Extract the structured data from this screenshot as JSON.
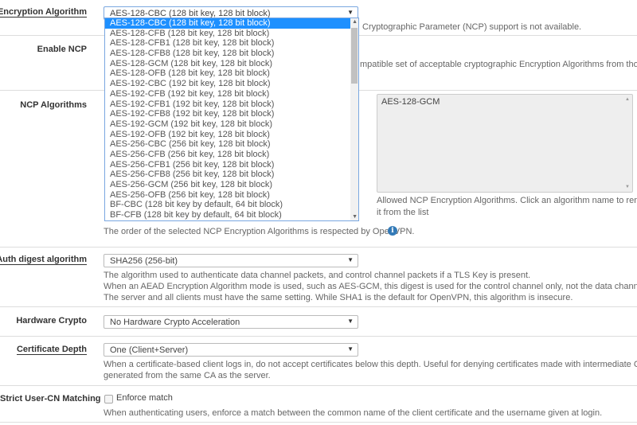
{
  "encryption": {
    "label": "Encryption Algorithm",
    "value": "AES-128-CBC (128 bit key, 128 bit block)",
    "help": "Cryptographic Parameter (NCP) support is not available.",
    "options": [
      "AES-128-CBC (128 bit key, 128 bit block)",
      "AES-128-CFB (128 bit key, 128 bit block)",
      "AES-128-CFB1 (128 bit key, 128 bit block)",
      "AES-128-CFB8 (128 bit key, 128 bit block)",
      "AES-128-GCM (128 bit key, 128 bit block)",
      "AES-128-OFB (128 bit key, 128 bit block)",
      "AES-192-CBC (192 bit key, 128 bit block)",
      "AES-192-CFB (192 bit key, 128 bit block)",
      "AES-192-CFB1 (192 bit key, 128 bit block)",
      "AES-192-CFB8 (192 bit key, 128 bit block)",
      "AES-192-GCM (192 bit key, 128 bit block)",
      "AES-192-OFB (192 bit key, 128 bit block)",
      "AES-256-CBC (256 bit key, 128 bit block)",
      "AES-256-CFB (256 bit key, 128 bit block)",
      "AES-256-CFB1 (256 bit key, 128 bit block)",
      "AES-256-CFB8 (256 bit key, 128 bit block)",
      "AES-256-GCM (256 bit key, 128 bit block)",
      "AES-256-OFB (256 bit key, 128 bit block)",
      "BF-CBC (128 bit key by default, 64 bit block)",
      "BF-CFB (128 bit key by default, 64 bit block)"
    ]
  },
  "ncp": {
    "label": "Enable NCP",
    "help": "mpatible set of acceptable cryptographic Encryption Algorithms from those"
  },
  "ncp_algorithms": {
    "label": "NCP Algorithms",
    "selected": [
      "AES-128-GCM"
    ],
    "help1": "Allowed NCP Encryption Algorithms. Click an algorithm name to remove",
    "help2": "it from the list",
    "order_note": "The order of the selected NCP Encryption Algorithms is respected by OpenVPN."
  },
  "auth": {
    "label": "Auth digest algorithm",
    "value": "SHA256 (256-bit)",
    "help": [
      "The algorithm used to authenticate data channel packets, and control channel packets if a TLS Key is present.",
      "When an AEAD Encryption Algorithm mode is used, such as AES-GCM, this digest is used for the control channel only, not the data channel.",
      "The server and all clients must have the same setting. While SHA1 is the default for OpenVPN, this algorithm is insecure."
    ]
  },
  "hw": {
    "label": "Hardware Crypto",
    "value": "No Hardware Crypto Acceleration"
  },
  "cert": {
    "label": "Certificate Depth",
    "value": "One (Client+Server)",
    "help": [
      "When a certificate-based client logs in, do not accept certificates below this depth. Useful for denying certificates made with intermediate CAs",
      "generated from the same CA as the server."
    ]
  },
  "strict": {
    "label": "Strict User-CN Matching",
    "checkbox": "Enforce match",
    "checked": false,
    "help": "When authenticating users, enforce a match between the common name of the client certificate and the username given at login."
  },
  "colors": {
    "accent": "#1e90ff",
    "info": "#337ab7"
  }
}
